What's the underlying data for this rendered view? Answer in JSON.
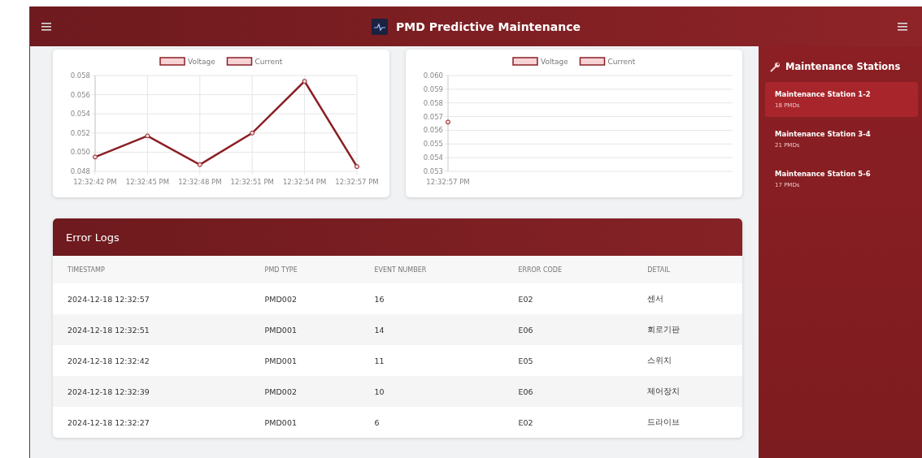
{
  "header": {
    "title": "PMD Predictive Maintenance"
  },
  "charts": [
    {
      "chart_data": {
        "type": "line",
        "grid": true,
        "categories": [
          "12:32:42 PM",
          "12:32:45 PM",
          "12:32:48 PM",
          "12:32:51 PM",
          "12:32:54 PM",
          "12:32:57 PM"
        ],
        "ylim": [
          0.048,
          0.058
        ],
        "yticks": [
          {
            "value": 0.048,
            "label": "0.048"
          },
          {
            "value": 0.05,
            "label": "0.050"
          },
          {
            "value": 0.052,
            "label": "0.052"
          },
          {
            "value": 0.054,
            "label": "0.054"
          },
          {
            "value": 0.056,
            "label": "0.056"
          },
          {
            "value": 0.058,
            "label": "0.058"
          }
        ],
        "series": [
          {
            "name": "Voltage",
            "color": "#8b1f24",
            "values": [
              null,
              null,
              null,
              null,
              null,
              null
            ]
          },
          {
            "name": "Current",
            "color": "#8b1f24",
            "marker": "circle",
            "values": [
              0.0495,
              0.0517,
              0.0487,
              0.052,
              0.0574,
              0.0485
            ]
          }
        ]
      }
    },
    {
      "chart_data": {
        "type": "line",
        "grid": true,
        "categories": [
          "12:32:57 PM"
        ],
        "ylim": [
          0.053,
          0.06
        ],
        "yticks": [
          {
            "value": 0.053,
            "label": "0.053"
          },
          {
            "value": 0.054,
            "label": "0.054"
          },
          {
            "value": 0.055,
            "label": "0.055"
          },
          {
            "value": 0.056,
            "label": "0.056"
          },
          {
            "value": 0.057,
            "label": "0.057"
          },
          {
            "value": 0.058,
            "label": "0.058"
          },
          {
            "value": 0.059,
            "label": "0.059"
          },
          {
            "value": 0.06,
            "label": "0.060"
          }
        ],
        "series": [
          {
            "name": "Voltage",
            "color": "#8b1f24",
            "values": [
              null
            ]
          },
          {
            "name": "Current",
            "color": "#8b1f24",
            "marker": "circle",
            "values": [
              0.0566
            ]
          }
        ]
      }
    }
  ],
  "error_logs": {
    "title": "Error Logs",
    "columns": [
      "TIMESTAMP",
      "PMD TYPE",
      "EVENT NUMBER",
      "ERROR CODE",
      "DETAIL"
    ],
    "rows": [
      [
        "2024-12-18 12:32:57",
        "PMD002",
        "16",
        "E02",
        "센서"
      ],
      [
        "2024-12-18 12:32:51",
        "PMD001",
        "14",
        "E06",
        "회로기판"
      ],
      [
        "2024-12-18 12:32:42",
        "PMD001",
        "11",
        "E05",
        "스위치"
      ],
      [
        "2024-12-18 12:32:39",
        "PMD002",
        "10",
        "E06",
        "제어장치"
      ],
      [
        "2024-12-18 12:32:27",
        "PMD001",
        "6",
        "E02",
        "드라이브"
      ]
    ]
  },
  "sidebar": {
    "title": "Maintenance Stations",
    "items": [
      {
        "name": "Maintenance Station 1-2",
        "count": "18 PMDs",
        "selected": true
      },
      {
        "name": "Maintenance Station 3-4",
        "count": "21 PMDs",
        "selected": false
      },
      {
        "name": "Maintenance Station 5-6",
        "count": "17 PMDs",
        "selected": false
      }
    ]
  }
}
